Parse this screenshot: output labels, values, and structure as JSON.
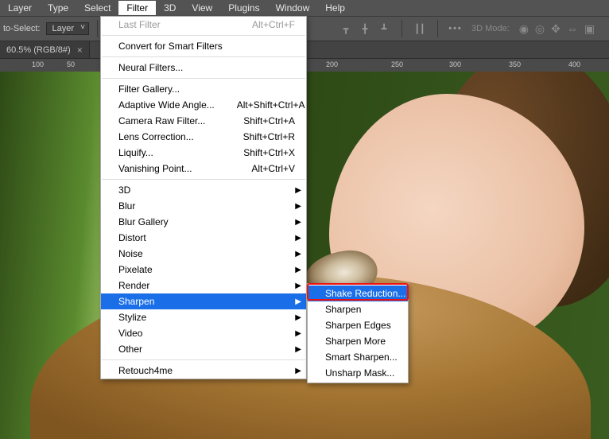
{
  "menubar": {
    "items": [
      "Layer",
      "Type",
      "Select",
      "Filter",
      "3D",
      "View",
      "Plugins",
      "Window",
      "Help"
    ],
    "open_index": 3
  },
  "options": {
    "autoselect_label": "to-Select:",
    "layer_select": "Layer",
    "mode_label": "3D Mode:"
  },
  "doc_tab": {
    "title": "60.5% (RGB/8#)",
    "close_glyph": "×"
  },
  "ruler": {
    "ticks": [
      {
        "pos": 40,
        "label": "100"
      },
      {
        "pos": 84,
        "label": "50"
      },
      {
        "pos": 410,
        "label": "200"
      },
      {
        "pos": 492,
        "label": "250"
      },
      {
        "pos": 565,
        "label": "300"
      },
      {
        "pos": 640,
        "label": "350"
      },
      {
        "pos": 715,
        "label": "400"
      }
    ]
  },
  "filter_menu": {
    "last_filter": {
      "label": "Last Filter",
      "shortcut": "Alt+Ctrl+F"
    },
    "convert": "Convert for Smart Filters",
    "neural": "Neural Filters...",
    "gallery": "Filter Gallery...",
    "adaptive": {
      "label": "Adaptive Wide Angle...",
      "shortcut": "Alt+Shift+Ctrl+A"
    },
    "camera_raw": {
      "label": "Camera Raw Filter...",
      "shortcut": "Shift+Ctrl+A"
    },
    "lens": {
      "label": "Lens Correction...",
      "shortcut": "Shift+Ctrl+R"
    },
    "liquify": {
      "label": "Liquify...",
      "shortcut": "Shift+Ctrl+X"
    },
    "vanishing": {
      "label": "Vanishing Point...",
      "shortcut": "Alt+Ctrl+V"
    },
    "sub_3d": "3D",
    "sub_blur": "Blur",
    "sub_blur_gallery": "Blur Gallery",
    "sub_distort": "Distort",
    "sub_noise": "Noise",
    "sub_pixelate": "Pixelate",
    "sub_render": "Render",
    "sub_sharpen": "Sharpen",
    "sub_stylize": "Stylize",
    "sub_video": "Video",
    "sub_other": "Other",
    "retouch": "Retouch4me"
  },
  "sharpen_sub": {
    "items": [
      "Shake Reduction...",
      "Sharpen",
      "Sharpen Edges",
      "Sharpen More",
      "Smart Sharpen...",
      "Unsharp Mask..."
    ],
    "highlight_index": 0
  }
}
